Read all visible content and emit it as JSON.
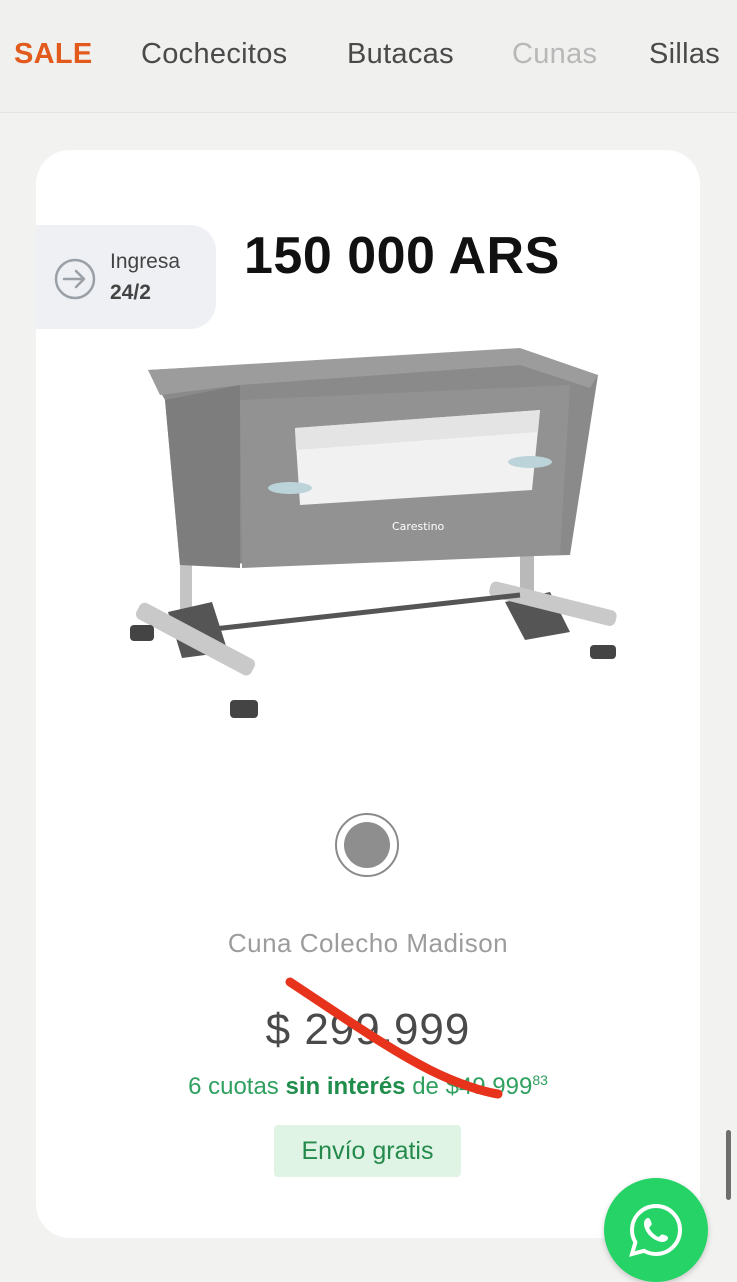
{
  "nav": {
    "items": [
      {
        "label": "SALE",
        "state": "highlight"
      },
      {
        "label": "Cochecitos",
        "state": "normal"
      },
      {
        "label": "Butacas",
        "state": "normal"
      },
      {
        "label": "Cunas",
        "state": "active-muted"
      },
      {
        "label": "Sillas",
        "state": "normal"
      }
    ]
  },
  "badge": {
    "line1": "Ingresa",
    "line2": "24/2",
    "icon": "arrow-circle-right-icon"
  },
  "overlay_price": "150 000 ARS",
  "product": {
    "image_brand_text": "Carestino",
    "color_swatch": "#8e8e8e",
    "name": "Cuna Colecho Madison",
    "price": "$ 299.999",
    "installments": {
      "prefix": "6 cuotas ",
      "bold": "sin interés",
      "middle": " de $49.999",
      "cents": "83"
    },
    "shipping_label": "Envío gratis"
  },
  "colors": {
    "sale": "#e25a1c",
    "green": "#2fa05f",
    "strike": "#e8331c",
    "whatsapp": "#25d366"
  }
}
